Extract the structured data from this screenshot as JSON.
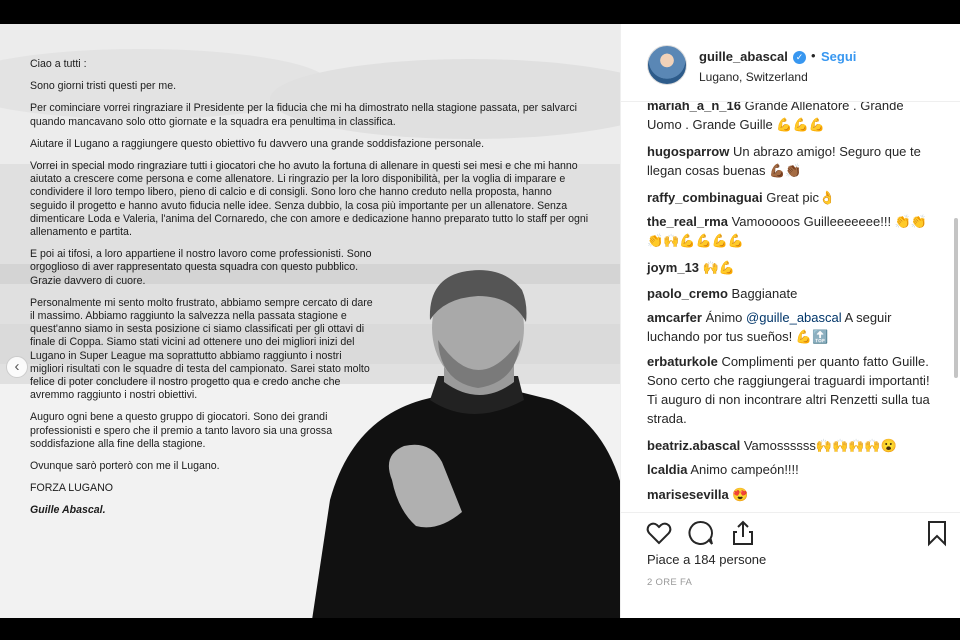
{
  "post": {
    "letter": [
      "Ciao a tutti :",
      "Sono giorni tristi questi per me.",
      "Per cominciare vorrei ringraziare il Presidente per la fiducia che mi ha dimostrato nella stagione passata, per salvarci quando mancavano solo otto giornate e la squadra era penultima in classifica.",
      "Aiutare il Lugano a raggiungere questo obiettivo fu davvero una grande soddisfazione personale.",
      "Vorrei in special modo ringraziare tutti i giocatori che ho avuto la fortuna di allenare in questi sei mesi e che mi hanno aiutato a crescere come persona e come allenatore. Li ringrazio per la loro disponibilità, per la voglia di imparare e condividere il loro tempo libero, pieno di calcio e di consigli. Sono loro che hanno creduto nella proposta, hanno seguido il progetto e hanno avuto fiducia nelle idee. Senza dubbio, la cosa più importante per un allenatore. Senza dimenticare Loda e Valeria, l'anima del Cornaredo, che con amore e dedicazione hanno preparato tutto lo staff per ogni allenamento e partita.",
      "E poi ai tifosi, a loro appartiene il nostro lavoro come professionisti. Sono orgoglioso di aver rappresentato questa squadra con questo pubblico. Grazie davvero di cuore.",
      "Personalmente mi sento molto frustrato, abbiamo sempre cercato di dare il massimo. Abbiamo raggiunto la salvezza nella passata stagione e quest'anno siamo in sesta posizione ci siamo classificati per gli ottavi di finale di Coppa. Siamo stati vicini ad ottenere uno dei migliori inizi del Lugano in Super League ma soprattutto abbiamo raggiunto i nostri migliori risultati con le squadre di testa del campionato. Sarei stato molto felice di poter concludere il nostro progetto qua e credo anche che avremmo raggiunto i nostri obiettivi.",
      "Auguro ogni bene a questo gruppo di giocatori. Sono dei grandi professionisti e spero che il premio a tanto lavoro sia una grossa soddisfazione alla fine della stagione.",
      "Ovunque sarò porterò con me il Lugano.",
      "FORZA LUGANO"
    ],
    "signature": "Guille Abascal."
  },
  "header": {
    "username": "guille_abascal",
    "verified_glyph": "✓",
    "separator": "•",
    "follow_label": "Segui",
    "location": "Lugano, Switzerland"
  },
  "comments": [
    {
      "user": "mariah_a_n_16",
      "text": "Grande Allenatore . Grande Uomo . Grande Guille 💪💪💪"
    },
    {
      "user": "hugosparrow",
      "text": "Un abrazo amigo! Seguro que te llegan cosas buenas 💪🏾👏🏾"
    },
    {
      "user": "raffy_combinaguai",
      "text": "Great pic👌"
    },
    {
      "user": "the_real_rma",
      "text": "Vamooooos Guilleeeeeee!!! 👏👏👏🙌💪💪💪💪"
    },
    {
      "user": "joym_13",
      "text": "🙌💪"
    },
    {
      "user": "paolo_cremo",
      "text": "Baggianate"
    },
    {
      "user": "amcarfer",
      "text_before": "Ánimo ",
      "mention": "@guille_abascal",
      "text_after": " A seguir luchando por tus sueños! 💪🔝"
    },
    {
      "user": "erbaturkole",
      "text": "Complimenti per quanto fatto Guille. Sono certo che raggiungerai traguardi importanti! Ti auguro di non incontrare altri Renzetti sulla tua strada."
    },
    {
      "user": "beatriz.abascal",
      "text": "Vamossssss🙌🙌🙌🙌😮"
    },
    {
      "user": "lcaldia",
      "text": "Animo campeón!!!!"
    },
    {
      "user": "marisesevilla",
      "text": "😍"
    }
  ],
  "actions": {
    "like_icon": "heart-icon",
    "comment_icon": "speech-bubble-icon",
    "share_icon": "share-icon",
    "save_icon": "bookmark-icon"
  },
  "likes_text": "Piace a 184 persone",
  "timestamp": "2 ORE FA",
  "nav_arrow": "‹",
  "colors": {
    "link": "#3897f0",
    "text": "#262626",
    "muted": "#999999",
    "mention": "#003569"
  }
}
